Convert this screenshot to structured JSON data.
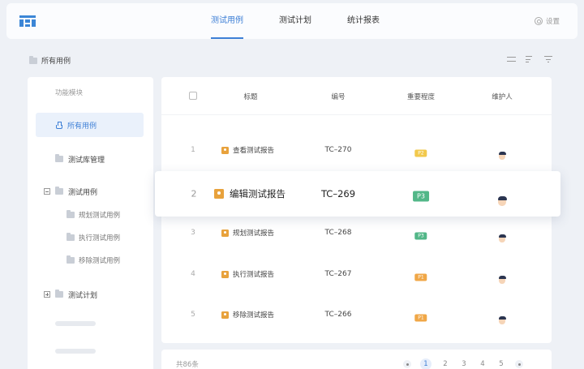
{
  "header": {
    "tabs": [
      {
        "label": "测试用例",
        "active": true
      },
      {
        "label": "测试计划",
        "active": false
      },
      {
        "label": "统计报表",
        "active": false
      }
    ],
    "settings_label": "设置"
  },
  "breadcrumb": {
    "label": "所有用例"
  },
  "sidebar": {
    "title": "功能模块",
    "items": [
      {
        "label": "所有用例"
      },
      {
        "label": "测试库管理"
      },
      {
        "label": "测试用例"
      },
      {
        "label": "测试计划"
      }
    ],
    "subitems": [
      {
        "label": "规划测试用例"
      },
      {
        "label": "执行测试用例"
      },
      {
        "label": "移除测试用例"
      }
    ]
  },
  "table": {
    "columns": [
      "标题",
      "编号",
      "重要程度",
      "维护人"
    ],
    "rows": [
      {
        "num": "1",
        "title": "查看测试报告",
        "code": "TC–270",
        "priority": "P2",
        "avatar_color": "#f2c94c"
      },
      {
        "num": "2",
        "title": "编辑测试报告",
        "code": "TC–269",
        "priority": "P3",
        "avatar_color": "#e2574c"
      },
      {
        "num": "3",
        "title": "规划测试报告",
        "code": "TC–268",
        "priority": "P3",
        "avatar_color": "#f2c94c"
      },
      {
        "num": "4",
        "title": "执行测试报告",
        "code": "TC–267",
        "priority": "P1",
        "avatar_color": "#f2c94c"
      },
      {
        "num": "5",
        "title": "移除测试报告",
        "code": "TC–266",
        "priority": "P1",
        "avatar_color": "#e2574c"
      }
    ]
  },
  "pagination": {
    "total": "共86条",
    "pages": [
      "1",
      "2",
      "3",
      "4",
      "5"
    ],
    "current": "1"
  },
  "colors": {
    "accent": "#3d7fd6",
    "P1": "#f0a747",
    "P2": "#f2c94c",
    "P3": "#52b788"
  }
}
